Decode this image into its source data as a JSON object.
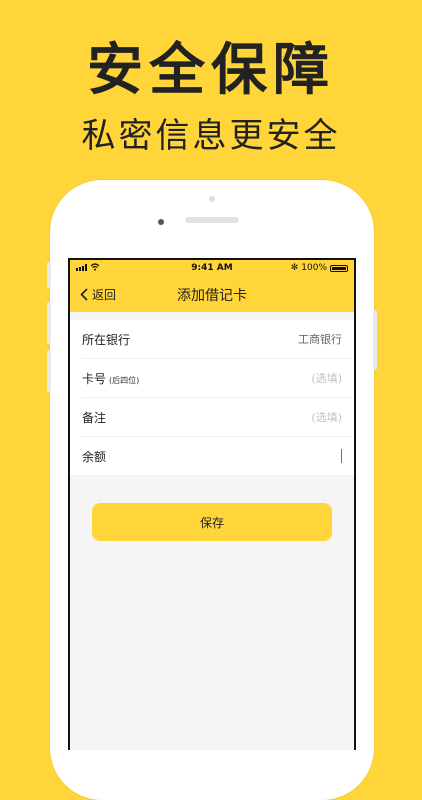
{
  "promo": {
    "headline": "安全保障",
    "subline": "私密信息更安全"
  },
  "status_bar": {
    "time": "9:41 AM",
    "battery": "100%",
    "bluetooth": "✻"
  },
  "navbar": {
    "back_label": "返回",
    "title": "添加借记卡"
  },
  "form": {
    "bank": {
      "label": "所在银行",
      "value": "工商银行"
    },
    "card": {
      "label": "卡号",
      "hint": "(后四位)",
      "placeholder": "(选填)"
    },
    "note": {
      "label": "备注",
      "placeholder": "(选填)"
    },
    "balance": {
      "label": "余额",
      "value": ""
    }
  },
  "actions": {
    "save_label": "保存"
  },
  "colors": {
    "accent": "#FFD53A",
    "background": "#F5F5F5",
    "cursor": "#2D7BE5"
  }
}
